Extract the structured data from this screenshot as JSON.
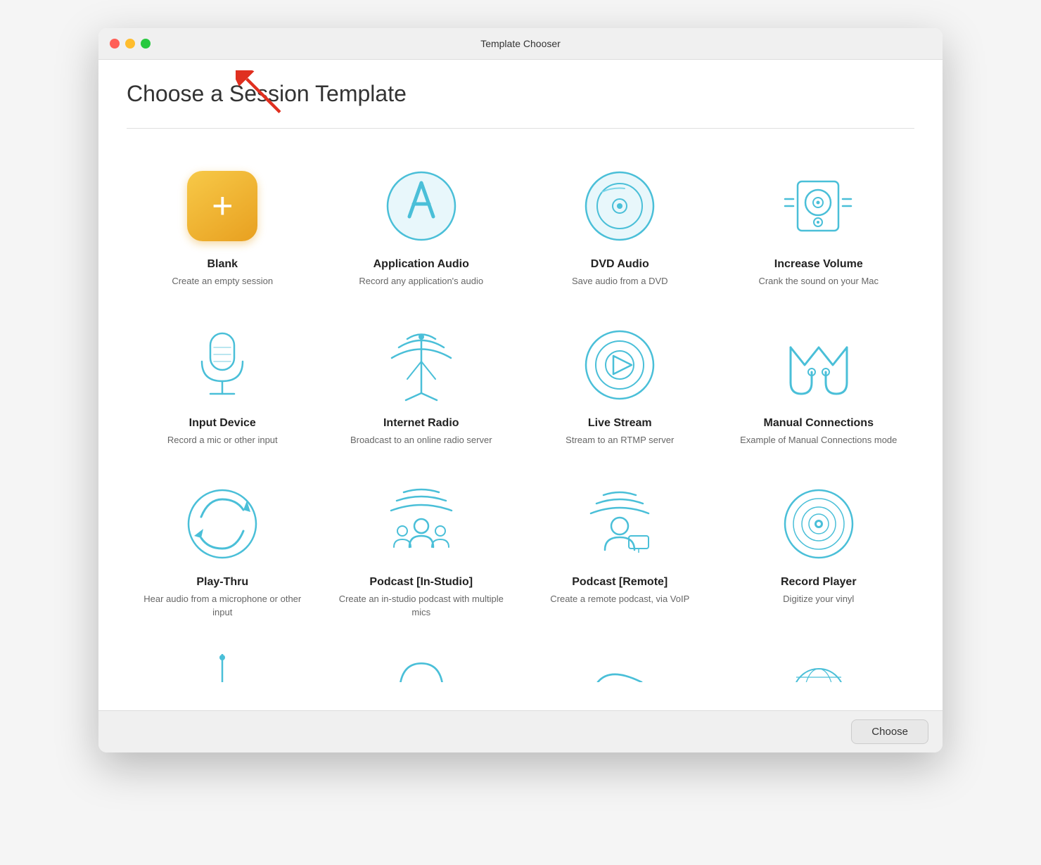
{
  "window": {
    "title": "Template Chooser",
    "traffic_lights": [
      "close",
      "minimize",
      "maximize"
    ]
  },
  "page": {
    "heading": "Choose a Session Template",
    "choose_button": "Choose"
  },
  "templates": [
    {
      "id": "blank",
      "label": "Blank",
      "desc": "Create an empty session",
      "icon_type": "blank"
    },
    {
      "id": "application-audio",
      "label": "Application Audio",
      "desc": "Record any application's audio",
      "icon_type": "app-audio"
    },
    {
      "id": "dvd-audio",
      "label": "DVD Audio",
      "desc": "Save audio from a DVD",
      "icon_type": "dvd"
    },
    {
      "id": "increase-volume",
      "label": "Increase Volume",
      "desc": "Crank the sound on your Mac",
      "icon_type": "speaker"
    },
    {
      "id": "input-device",
      "label": "Input Device",
      "desc": "Record a mic or other input",
      "icon_type": "mic"
    },
    {
      "id": "internet-radio",
      "label": "Internet Radio",
      "desc": "Broadcast to an online radio server",
      "icon_type": "radio-tower"
    },
    {
      "id": "live-stream",
      "label": "Live Stream",
      "desc": "Stream to an RTMP server",
      "icon_type": "livestream"
    },
    {
      "id": "manual-connections",
      "label": "Manual Connections",
      "desc": "Example of Manual Connections mode",
      "icon_type": "manual"
    },
    {
      "id": "play-thru",
      "label": "Play-Thru",
      "desc": "Hear audio from a microphone or other input",
      "icon_type": "playthru"
    },
    {
      "id": "podcast-studio",
      "label": "Podcast [In-Studio]",
      "desc": "Create an in-studio podcast with multiple mics",
      "icon_type": "podcast-studio"
    },
    {
      "id": "podcast-remote",
      "label": "Podcast [Remote]",
      "desc": "Create a remote podcast, via VoIP",
      "icon_type": "podcast-remote"
    },
    {
      "id": "record-player",
      "label": "Record Player",
      "desc": "Digitize your vinyl",
      "icon_type": "record"
    }
  ],
  "partial_templates": [
    {
      "id": "partial-1",
      "icon_type": "partial-tower"
    },
    {
      "id": "partial-2",
      "icon_type": "partial-headphones"
    },
    {
      "id": "partial-3",
      "icon_type": "partial-mic2"
    },
    {
      "id": "partial-4",
      "icon_type": "partial-globe"
    }
  ],
  "colors": {
    "icon_blue": "#4abfd8",
    "icon_blue_light": "#7dd6e8",
    "blank_gold": "#f5a623",
    "arrow_red": "#e03020"
  }
}
